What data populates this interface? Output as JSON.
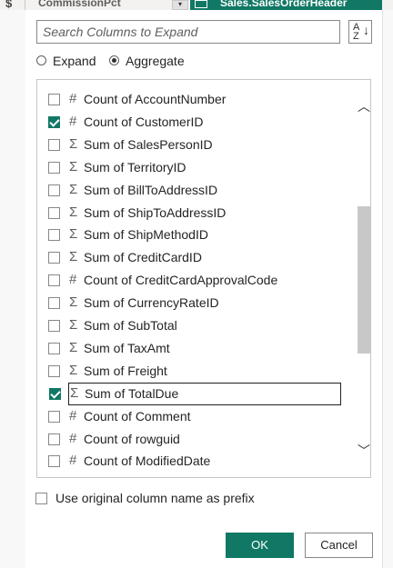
{
  "background": {
    "type_icon": "$",
    "column_label": "CommissionPct",
    "table_label": "Sales.SalesOrderHeader"
  },
  "search": {
    "placeholder": "Search Columns to Expand"
  },
  "mode": {
    "expand_label": "Expand",
    "aggregate_label": "Aggregate",
    "selected": "Aggregate"
  },
  "columns": [
    {
      "icon": "#",
      "label": "Count of AccountNumber",
      "checked": false
    },
    {
      "icon": "#",
      "label": "Count of CustomerID",
      "checked": true
    },
    {
      "icon": "Σ",
      "label": "Sum of SalesPersonID",
      "checked": false
    },
    {
      "icon": "Σ",
      "label": "Sum of TerritoryID",
      "checked": false
    },
    {
      "icon": "Σ",
      "label": "Sum of BillToAddressID",
      "checked": false
    },
    {
      "icon": "Σ",
      "label": "Sum of ShipToAddressID",
      "checked": false
    },
    {
      "icon": "Σ",
      "label": "Sum of ShipMethodID",
      "checked": false
    },
    {
      "icon": "Σ",
      "label": "Sum of CreditCardID",
      "checked": false
    },
    {
      "icon": "#",
      "label": "Count of CreditCardApprovalCode",
      "checked": false
    },
    {
      "icon": "Σ",
      "label": "Sum of CurrencyRateID",
      "checked": false
    },
    {
      "icon": "Σ",
      "label": "Sum of SubTotal",
      "checked": false
    },
    {
      "icon": "Σ",
      "label": "Sum of TaxAmt",
      "checked": false
    },
    {
      "icon": "Σ",
      "label": "Sum of Freight",
      "checked": false
    },
    {
      "icon": "Σ",
      "label": "Sum of TotalDue",
      "checked": true
    },
    {
      "icon": "#",
      "label": "Count of Comment",
      "checked": false
    },
    {
      "icon": "#",
      "label": "Count of rowguid",
      "checked": false
    },
    {
      "icon": "#",
      "label": "Count of ModifiedDate",
      "checked": false
    }
  ],
  "prefix_option": {
    "label": "Use original column name as prefix",
    "checked": false
  },
  "buttons": {
    "ok": "OK",
    "cancel": "Cancel"
  },
  "colors": {
    "accent": "#117865",
    "border": "#8a8886"
  },
  "icons": {
    "sort": "sort-az-icon",
    "scroll_up": "chevron-up-icon",
    "scroll_down": "chevron-down-icon",
    "hash": "hash-icon",
    "sigma": "sigma-icon"
  }
}
